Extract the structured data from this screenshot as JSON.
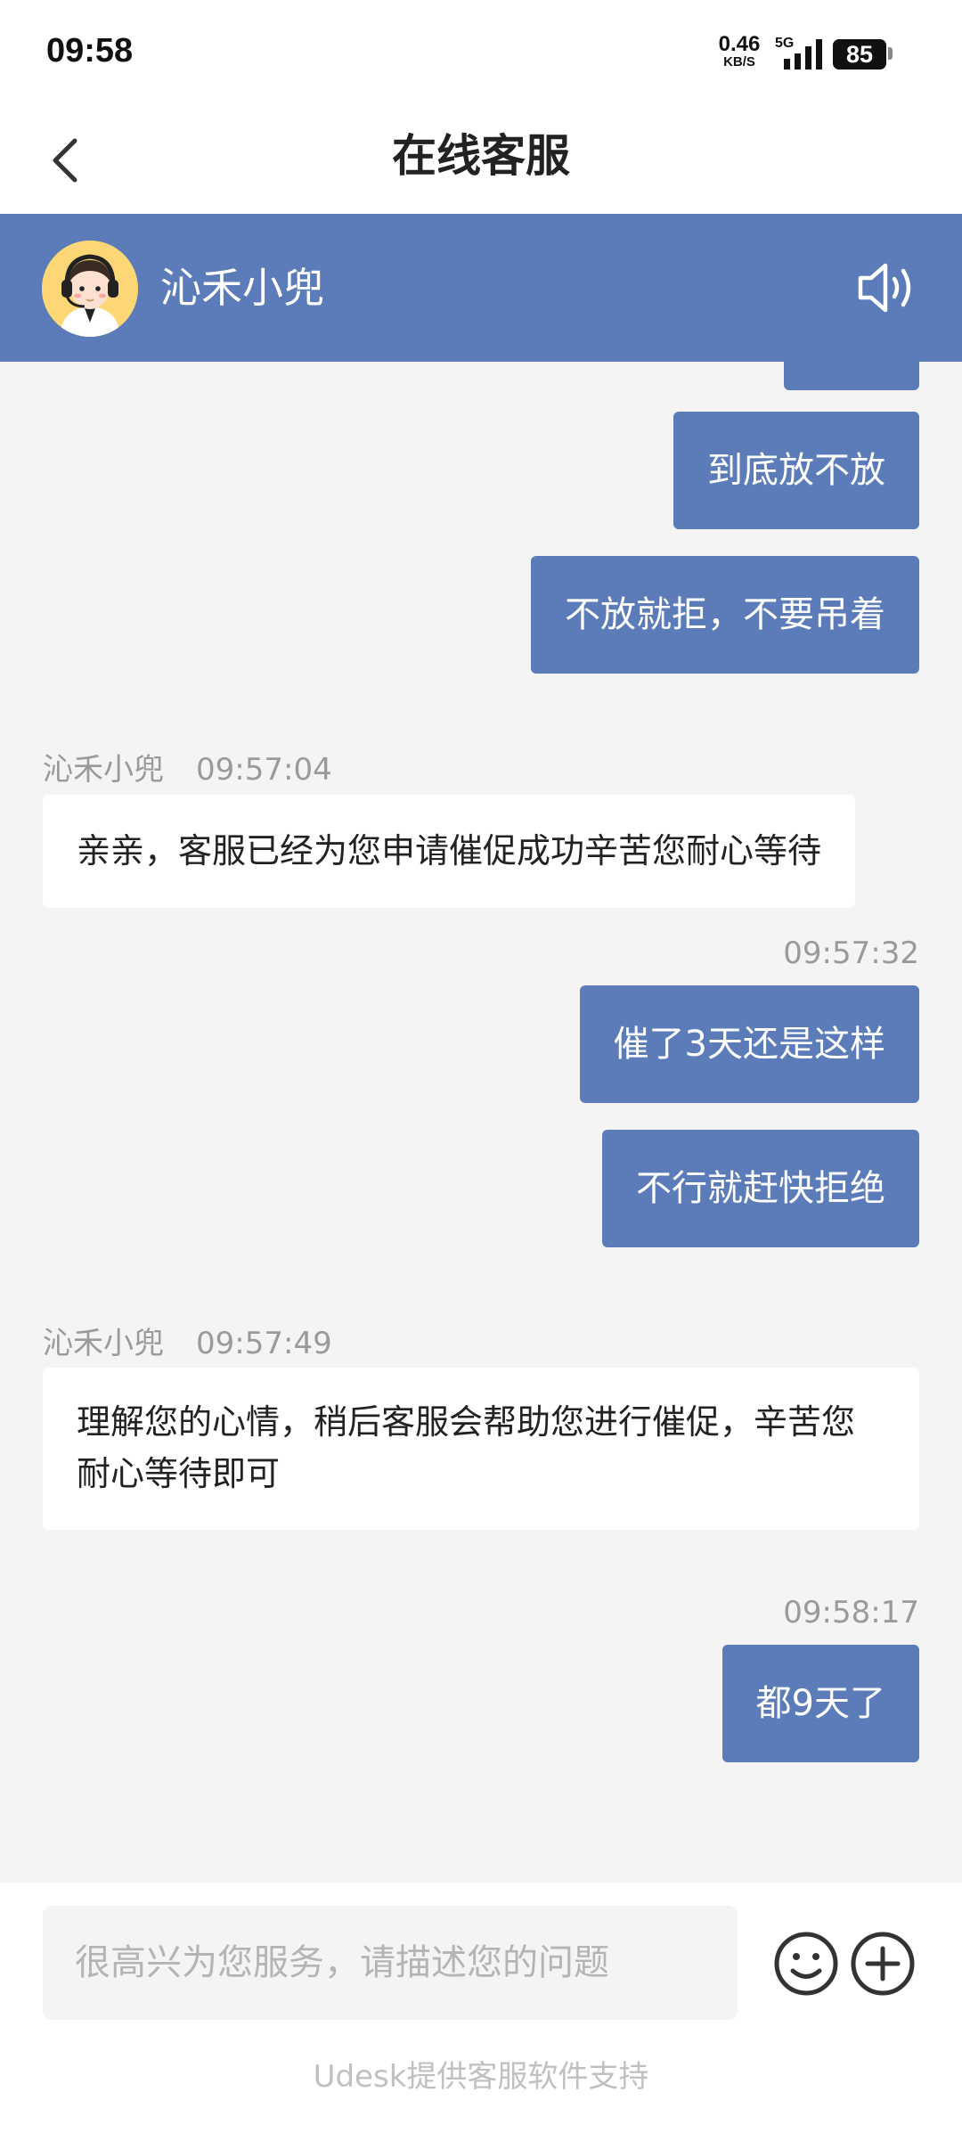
{
  "status_bar": {
    "time": "09:58",
    "net_speed_value": "0.46",
    "net_speed_unit": "KB/S",
    "network": "5G",
    "battery": "85"
  },
  "header": {
    "title": "在线客服"
  },
  "agent": {
    "name": "沁禾小兜"
  },
  "messages": [
    {
      "from": "user",
      "text": "到底放不放"
    },
    {
      "from": "user",
      "text": "不放就拒，不要吊着"
    },
    {
      "from": "agent",
      "sender": "沁禾小兜",
      "time": "09:57:04",
      "text": "亲亲，客服已经为您申请催促成功辛苦您耐心等待"
    },
    {
      "from": "user",
      "time": "09:57:32",
      "text": "催了3天还是这样"
    },
    {
      "from": "user",
      "text": "不行就赶快拒绝"
    },
    {
      "from": "agent",
      "sender": "沁禾小兜",
      "time": "09:57:49",
      "text": "理解您的心情，稍后客服会帮助您进行催促，辛苦您耐心等待即可"
    },
    {
      "from": "user",
      "time": "09:58:17",
      "text": "都9天了"
    }
  ],
  "input": {
    "placeholder": "很高兴为您服务，请描述您的问题",
    "value": ""
  },
  "footer": {
    "text": "Udesk提供客服软件支持"
  },
  "icons": {
    "back": "chevron-left-icon",
    "speaker": "speaker-icon",
    "emoji": "smiley-icon",
    "plus": "plus-circle-icon"
  },
  "colors": {
    "accent": "#5b7cb8",
    "background": "#f4f4f4",
    "bubble_in": "#ffffff",
    "meta_text": "#9a9a9a"
  }
}
